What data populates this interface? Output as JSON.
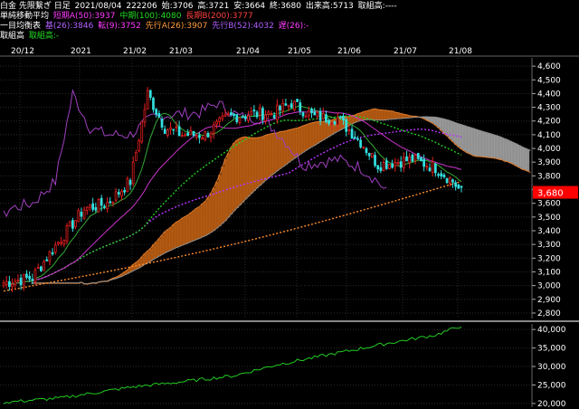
{
  "header": {
    "line1": {
      "instrument": "白金 先限繋ぎ 日足",
      "date": "2021/08/04",
      "volume": "222206",
      "open": "始:3706",
      "high": "高:3721",
      "low": "安:3664",
      "close": "終:3680",
      "oi": "出来高:5713",
      "torikumi": "取組高:----"
    },
    "line2": {
      "label": "単純移動平均",
      "ma_short": "短期A(50):3937",
      "ma_mid": "中期(100):4080",
      "ma_long": "長期B(200):3777"
    },
    "line3": {
      "label": "一目均衡表",
      "kijun": "基(26):3846",
      "tenkan": "転(9):3752",
      "senkouA": "先行A(26):3907",
      "senkouB": "先行B(52):4032",
      "chikou": "遅(26):-"
    },
    "line4": {
      "label": "取組高",
      "value": "取組高:-"
    }
  },
  "colors": {
    "background": "#000000",
    "grid": "#2a2a2a",
    "up_candle": "#e61e1e",
    "down_candle": "#33e0e0",
    "ma50": "#22cc22",
    "ma100": "#bb33ff",
    "ma200": "#ff8c2a",
    "tenkan": "#8833cc",
    "kijun": "#cc33cc",
    "cloud_bull": "#c86414",
    "cloud_bear": "#aaaaaa",
    "price_tag": "#ff0000",
    "oi_line": "#22cc22"
  },
  "chart_data": {
    "type": "candlestick",
    "timeframe": "daily",
    "x_labels": [
      "20/12",
      "2021",
      "21/02",
      "21/03",
      "21/04",
      "21/05",
      "21/06",
      "21/07",
      "21/08"
    ],
    "y_ticks": [
      "4,600",
      "4,500",
      "4,400",
      "4,300",
      "4,200",
      "4,100",
      "4,000",
      "3,900",
      "3,800",
      "3,700",
      "3,600",
      "3,500",
      "3,400",
      "3,300",
      "3,200",
      "3,100",
      "3,000",
      "2,900",
      "2,800"
    ],
    "ylim": [
      2760,
      4660
    ],
    "last_price": "3,680",
    "oi_ticks": [
      "40,000",
      "35,000",
      "30,000",
      "25,000",
      "20,000"
    ],
    "oi_ylim": [
      19000,
      41500
    ]
  }
}
